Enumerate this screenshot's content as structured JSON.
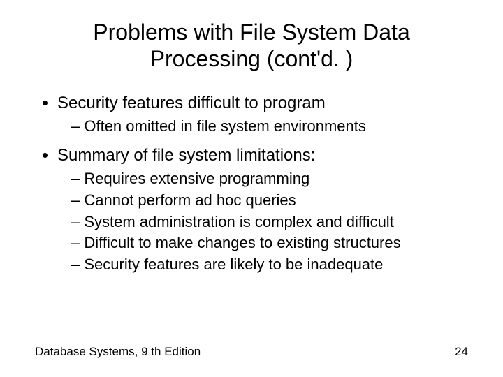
{
  "title": "Problems with File System Data Processing (cont'd. )",
  "bullets": [
    {
      "text": "Security features difficult to program",
      "sub": [
        "Often omitted in file system environments"
      ]
    },
    {
      "text": "Summary of file system limitations:",
      "sub": [
        "Requires extensive programming",
        "Cannot perform ad hoc queries",
        "System administration is complex and difficult",
        "Difficult to make changes to existing structures",
        "Security features are likely to be inadequate"
      ]
    }
  ],
  "footer_left": "Database Systems, 9 th Edition",
  "footer_right": "24"
}
